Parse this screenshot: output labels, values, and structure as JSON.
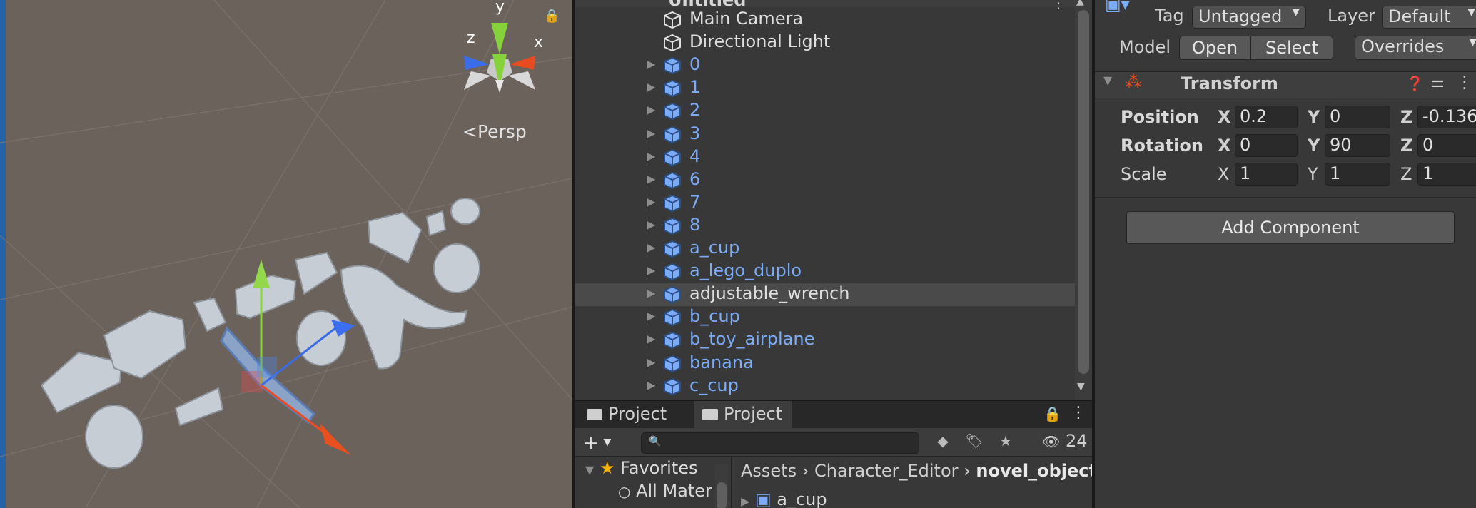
{
  "scene": {
    "projection_label": "Persp",
    "gizmo_axes": {
      "x": "x",
      "y": "y",
      "z": "z"
    }
  },
  "hierarchy": {
    "scene_title": "Untitled",
    "items": [
      {
        "label": "Main Camera",
        "style": "white",
        "expandable": false,
        "selected": false
      },
      {
        "label": "Directional Light",
        "style": "white",
        "expandable": false,
        "selected": false
      },
      {
        "label": "0",
        "style": "blue",
        "expandable": true,
        "selected": false
      },
      {
        "label": "1",
        "style": "blue",
        "expandable": true,
        "selected": false
      },
      {
        "label": "2",
        "style": "blue",
        "expandable": true,
        "selected": false
      },
      {
        "label": "3",
        "style": "blue",
        "expandable": true,
        "selected": false
      },
      {
        "label": "4",
        "style": "blue",
        "expandable": true,
        "selected": false
      },
      {
        "label": "6",
        "style": "blue",
        "expandable": true,
        "selected": false
      },
      {
        "label": "7",
        "style": "blue",
        "expandable": true,
        "selected": false
      },
      {
        "label": "8",
        "style": "blue",
        "expandable": true,
        "selected": false
      },
      {
        "label": "a_cup",
        "style": "blue",
        "expandable": true,
        "selected": false
      },
      {
        "label": "a_lego_duplo",
        "style": "blue",
        "expandable": true,
        "selected": false
      },
      {
        "label": "adjustable_wrench",
        "style": "white",
        "expandable": true,
        "selected": true
      },
      {
        "label": "b_cup",
        "style": "blue",
        "expandable": true,
        "selected": false
      },
      {
        "label": "b_toy_airplane",
        "style": "blue",
        "expandable": true,
        "selected": false
      },
      {
        "label": "banana",
        "style": "blue",
        "expandable": true,
        "selected": false
      },
      {
        "label": "c_cup",
        "style": "blue",
        "expandable": true,
        "selected": false
      }
    ]
  },
  "project": {
    "tabs": [
      {
        "label": "Project"
      },
      {
        "label": "Project"
      }
    ],
    "hidden_count": "24",
    "favorites_label": "Favorites",
    "favorites_item": "All Materials",
    "breadcrumb": [
      "Assets",
      "Character_Editor",
      "novel_objects"
    ],
    "first_asset": "a_cup"
  },
  "inspector": {
    "tag_label": "Tag",
    "tag_value": "Untagged",
    "layer_label": "Layer",
    "layer_value": "Default",
    "model_label": "Model",
    "open_label": "Open",
    "select_label": "Select",
    "overrides_label": "Overrides",
    "transform_title": "Transform",
    "position": {
      "label": "Position",
      "x": "0.2",
      "y": "0",
      "z": "-0.136"
    },
    "rotation": {
      "label": "Rotation",
      "x": "0",
      "y": "90",
      "z": "0"
    },
    "scale": {
      "label": "Scale",
      "x": "1",
      "y": "1",
      "z": "1"
    },
    "add_component_label": "Add Component"
  },
  "colors": {
    "prefab_blue": "#7cacf8",
    "scene_bg": "#6b625b",
    "panel_bg": "#383838"
  }
}
